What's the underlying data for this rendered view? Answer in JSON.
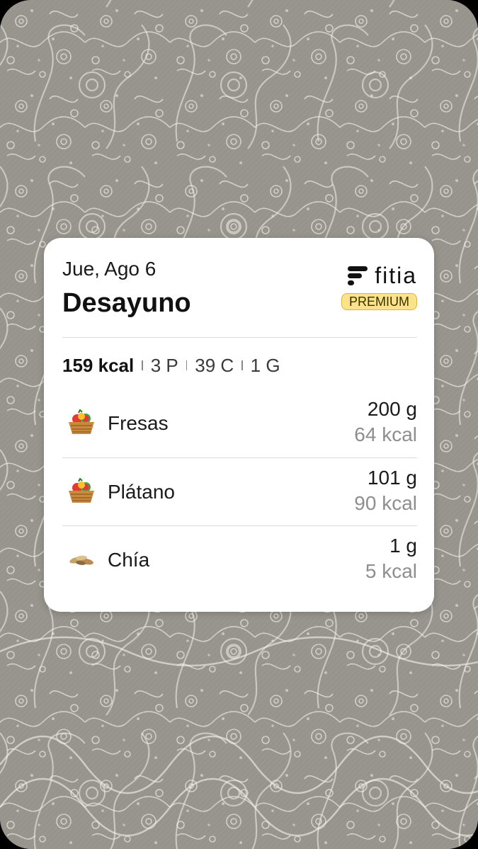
{
  "widget": {
    "date": "Jue, Ago 6",
    "meal": "Desayuno",
    "brand": {
      "name": "fitia",
      "badge": "PREMIUM",
      "badge_color": "#fbe389"
    },
    "summary": {
      "kcal": "159 kcal",
      "protein": "3 P",
      "carbs": "39 C",
      "fat": "1 G"
    },
    "foods": [
      {
        "icon": "fruit-basket-icon",
        "name": "Fresas",
        "quantity": "200 g",
        "kcal": "64 kcal"
      },
      {
        "icon": "fruit-basket-icon",
        "name": "Plátano",
        "quantity": "101 g",
        "kcal": "90 kcal"
      },
      {
        "icon": "seeds-icon",
        "name": "Chía",
        "quantity": "1 g",
        "kcal": "5 kcal"
      }
    ]
  },
  "colors": {
    "card_background": "#ffffff",
    "secondary_text": "#8e8e8e",
    "wallpaper": "#9a9690"
  }
}
